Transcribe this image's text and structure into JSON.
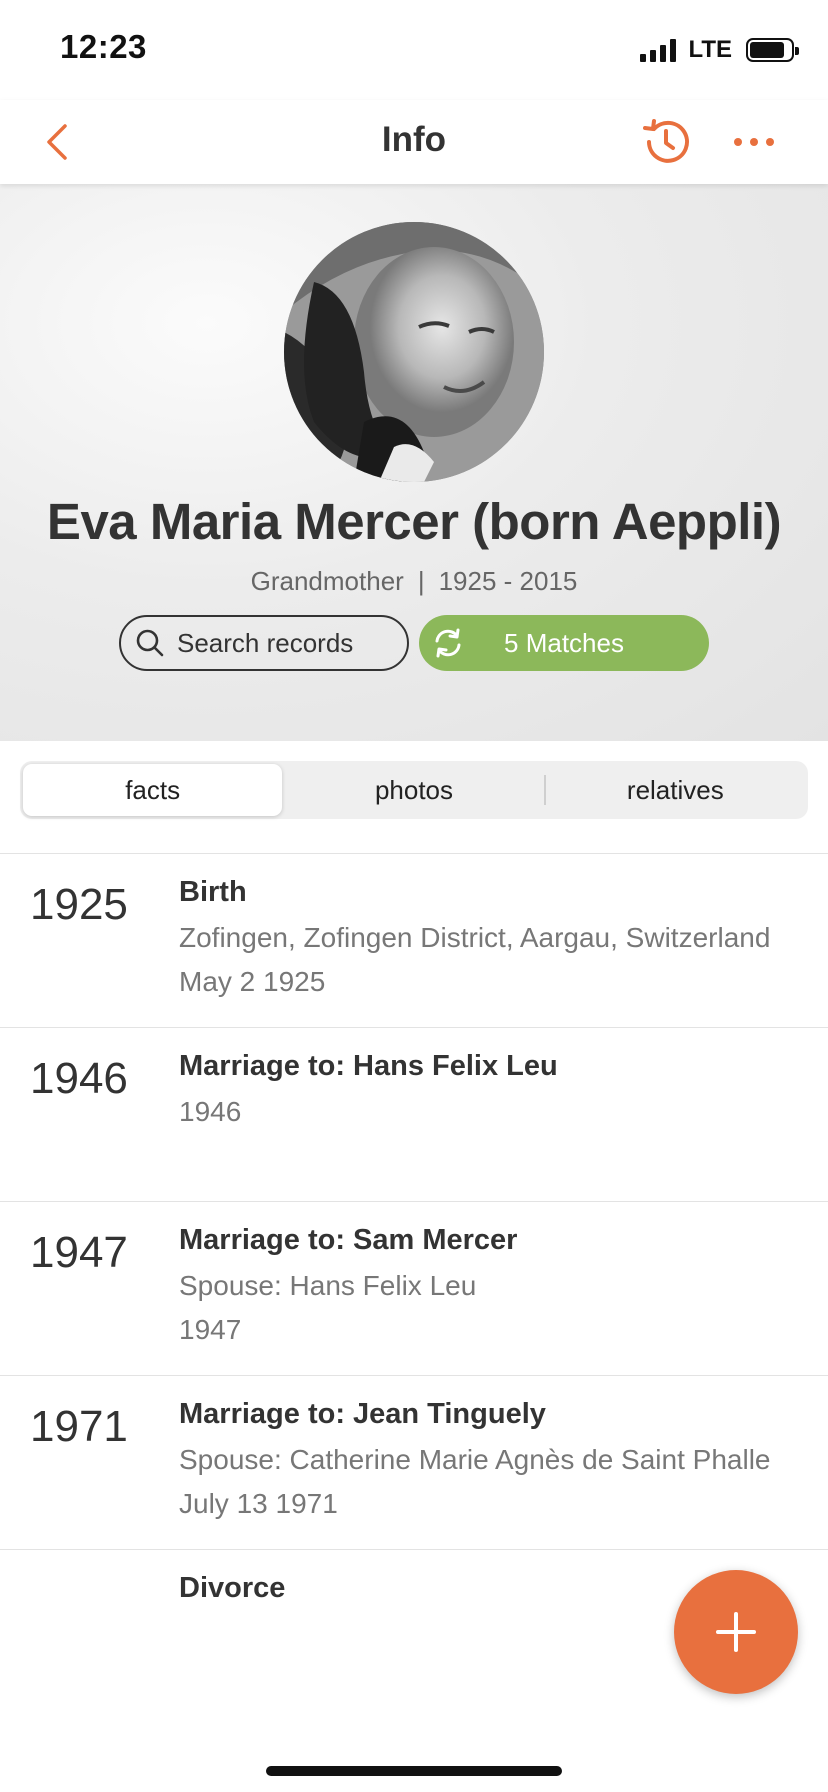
{
  "status_bar": {
    "time": "12:23",
    "network": "LTE",
    "icons": [
      "signal-icon",
      "battery-icon"
    ]
  },
  "nav": {
    "title": "Info",
    "icons": [
      "chevron-left-icon",
      "history-icon",
      "more-dots-icon"
    ]
  },
  "profile": {
    "name": "Eva Maria Mercer (born Aeppli)",
    "relation": "Grandmother",
    "separator": "|",
    "lifespan": "1925 - 2015",
    "search_label": "Search records",
    "matches_label": "5 Matches"
  },
  "tabs": [
    {
      "label": "facts",
      "active": true
    },
    {
      "label": "photos",
      "active": false
    },
    {
      "label": "relatives",
      "active": false
    }
  ],
  "facts": [
    {
      "year": "1925",
      "title": "Birth",
      "line1": "Zofingen, Zofingen District, Aargau, Switzerland",
      "line2": "May 2 1925"
    },
    {
      "year": "1946",
      "title": "Marriage to: Hans Felix Leu",
      "line1": "1946",
      "line2": ""
    },
    {
      "year": "1947",
      "title": "Marriage to: Sam Mercer",
      "line1": "Spouse: Hans Felix Leu",
      "line2": "1947"
    },
    {
      "year": "1971",
      "title": "Marriage to: Jean Tinguely",
      "line1": "Spouse: Catherine Marie Agnès de Saint Phalle",
      "line2": "July 13 1971"
    },
    {
      "year": "",
      "title": "Divorce",
      "line1": "",
      "line2": ""
    }
  ],
  "colors": {
    "accent": "#e8703e",
    "matches_green": "#8cb85a"
  }
}
